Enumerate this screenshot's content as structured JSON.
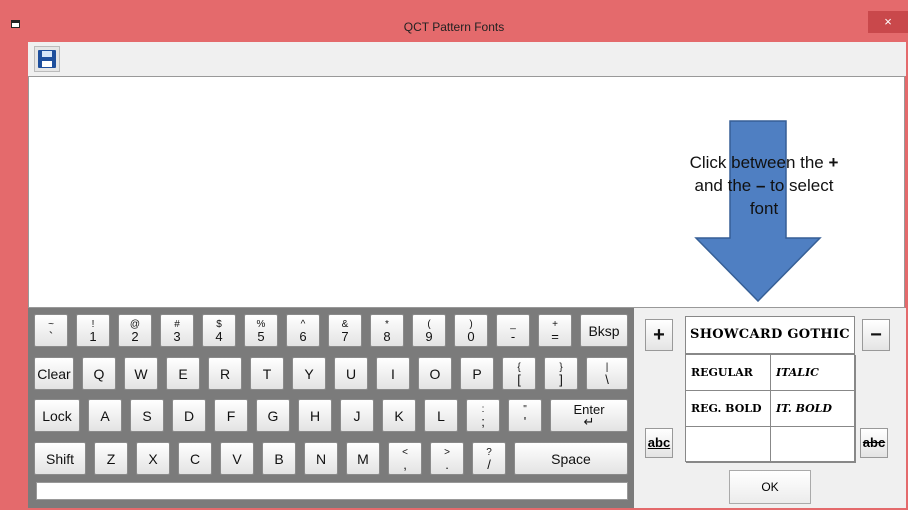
{
  "window": {
    "title": "QCT Pattern Fonts",
    "close_glyph": "×"
  },
  "toolbar": {
    "save_icon": "floppy-disk-icon"
  },
  "hint": {
    "line1_a": "Click between the ",
    "line1_b": "+",
    "line2_a": "and the ",
    "line2_b": "–",
    "line2_c": " to select",
    "line3": "font"
  },
  "keyboard": {
    "row1": [
      {
        "top": "~",
        "bottom": "`"
      },
      {
        "top": "!",
        "bottom": "1"
      },
      {
        "top": "@",
        "bottom": "2"
      },
      {
        "top": "#",
        "bottom": "3"
      },
      {
        "top": "$",
        "bottom": "4"
      },
      {
        "top": "%",
        "bottom": "5"
      },
      {
        "top": "^",
        "bottom": "6"
      },
      {
        "top": "&",
        "bottom": "7"
      },
      {
        "top": "*",
        "bottom": "8"
      },
      {
        "top": "(",
        "bottom": "9"
      },
      {
        "top": ")",
        "bottom": "0"
      },
      {
        "top": "_",
        "bottom": "-"
      },
      {
        "top": "+",
        "bottom": "="
      }
    ],
    "bksp": "Bksp",
    "clear": "Clear",
    "row2_letters": [
      "Q",
      "W",
      "E",
      "R",
      "T",
      "Y",
      "U",
      "I",
      "O",
      "P"
    ],
    "row2_sym": [
      {
        "top": "{",
        "bottom": "["
      },
      {
        "top": "}",
        "bottom": "]"
      },
      {
        "top": "|",
        "bottom": "\\"
      }
    ],
    "lock": "Lock",
    "row3_letters": [
      "A",
      "S",
      "D",
      "F",
      "G",
      "H",
      "J",
      "K",
      "L"
    ],
    "row3_sym": [
      {
        "top": ":",
        "bottom": ";"
      },
      {
        "top": "\"",
        "bottom": "'"
      }
    ],
    "enter": "Enter",
    "enter_glyph": "↵",
    "shift": "Shift",
    "row4_letters": [
      "Z",
      "X",
      "C",
      "V",
      "B",
      "N",
      "M"
    ],
    "row4_sym": [
      {
        "top": "<",
        "bottom": ","
      },
      {
        "top": ">",
        "bottom": "."
      },
      {
        "top": "?",
        "bottom": "/"
      }
    ],
    "space": "Space"
  },
  "fontpanel": {
    "plus": "+",
    "minus": "−",
    "font_name": "SHOWCARD GOTHIC",
    "styles": {
      "regular": "REGULAR",
      "italic": "ITALIC",
      "reg_bold": "REG. BOLD",
      "it_bold": "IT. BOLD"
    },
    "abc": "abc",
    "abc_strike": "abc",
    "ok": "OK"
  },
  "colors": {
    "frame": "#e46a6c",
    "arrow_fill": "#4f7fc2",
    "arrow_stroke": "#365f96"
  }
}
